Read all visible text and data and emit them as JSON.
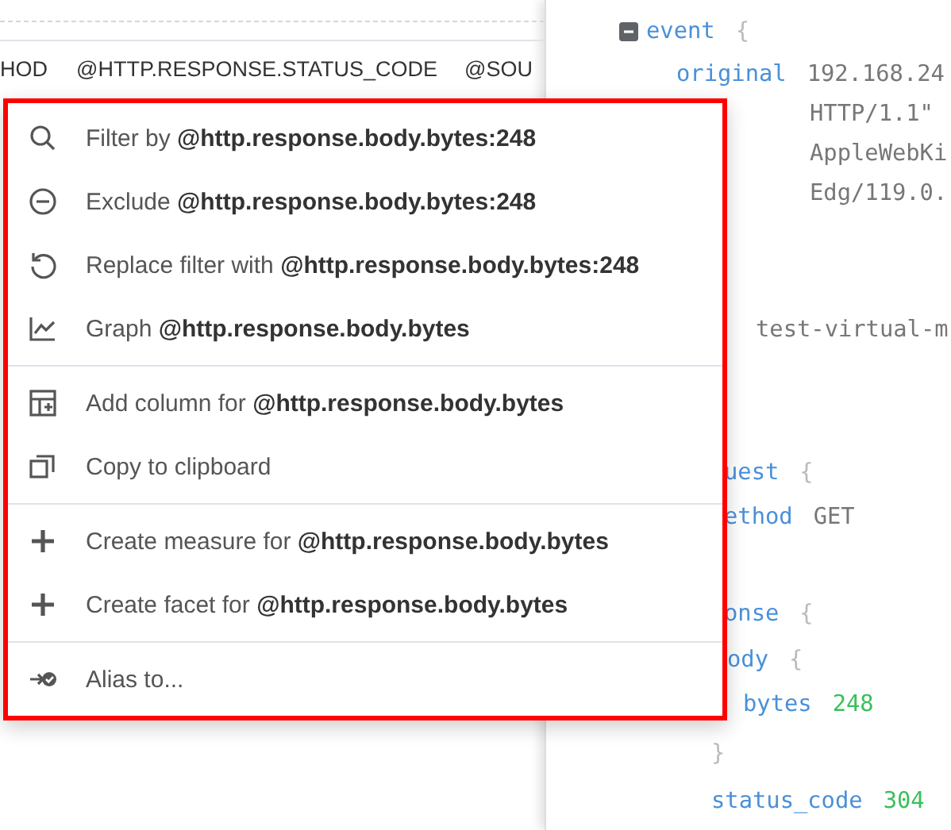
{
  "table": {
    "columns": [
      "HOD",
      "@HTTP.RESPONSE.STATUS_CODE",
      "@SOU"
    ]
  },
  "json_view": {
    "lines": [
      {
        "key": "event",
        "brace": "{",
        "collapse_icon": true
      },
      {
        "key": "original",
        "value": "192.168.24"
      },
      {
        "value": "HTTP/1.1\""
      },
      {
        "value": "AppleWebKi"
      },
      {
        "value": "Edg/119.0."
      },
      {
        "value": "test-virtual-m"
      },
      {
        "key": "uest",
        "brace": "{"
      },
      {
        "key": "ethod",
        "value": "GET"
      },
      {
        "key": "onse",
        "brace": "{"
      },
      {
        "key": "ody",
        "brace": "{"
      },
      {
        "key": "bytes",
        "number": "248"
      },
      {
        "brace": "}"
      },
      {
        "key": "status_code",
        "number": "304"
      }
    ]
  },
  "context_menu": {
    "groups": [
      [
        {
          "label": "Filter by **@http.response.body.bytes:248**"
        },
        {
          "label": "Exclude **@http.response.body.bytes:248**"
        },
        {
          "label": "Replace filter with **@http.response.body.bytes:248**"
        },
        {
          "label": "Graph **@http.response.body.bytes**"
        }
      ],
      [
        {
          "label": "Add column for **@http.response.body.bytes**"
        },
        {
          "label": "Copy to clipboard"
        }
      ],
      [
        {
          "label": "Create measure for **@http.response.body.bytes**"
        },
        {
          "label": "Create facet for **@http.response.body.bytes**"
        }
      ],
      [
        {
          "label": "Alias to..."
        }
      ]
    ]
  }
}
